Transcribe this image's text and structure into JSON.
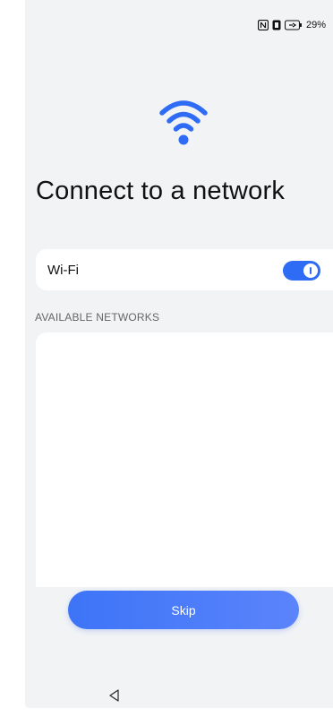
{
  "status_bar": {
    "icons": [
      "nfc-icon",
      "vibrate-icon",
      "battery-charging-icon"
    ],
    "battery_text": "29%"
  },
  "hero": {
    "icon": "wifi-icon",
    "title": "Connect to a network"
  },
  "wifi_toggle": {
    "label": "Wi-Fi",
    "enabled": true
  },
  "networks_section": {
    "header": "AVAILABLE NETWORKS",
    "items": []
  },
  "actions": {
    "skip_label": "Skip"
  },
  "navigation": {
    "back_icon": "back-triangle-icon"
  },
  "colors": {
    "accent": "#2f6cf5",
    "background": "#f1f3f5",
    "card": "#ffffff"
  }
}
